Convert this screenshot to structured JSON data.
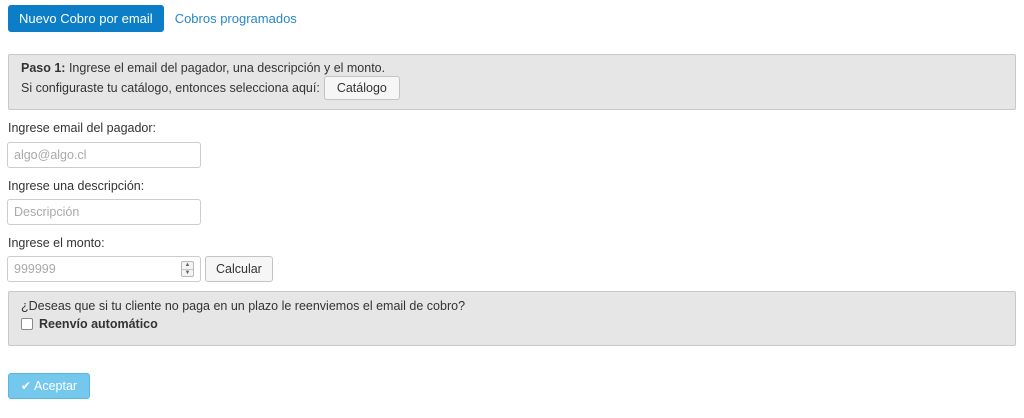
{
  "tabs": {
    "active_label": "Nuevo Cobro por email",
    "secondary_label": "Cobros programados"
  },
  "step_panel": {
    "step_bold": "Paso 1:",
    "step_text": " Ingrese el email del pagador, una descripción y el monto.",
    "catalog_text": "Si configuraste tu catálogo, entonces selecciona aquí:",
    "catalog_button": "Catálogo"
  },
  "form": {
    "email_label": "Ingrese email del pagador:",
    "email_placeholder": "algo@algo.cl",
    "email_value": "",
    "description_label": "Ingrese una descripción:",
    "description_placeholder": "Descripción",
    "description_value": "",
    "amount_label": "Ingrese el monto:",
    "amount_placeholder": "999999",
    "amount_value": "",
    "calculate_button": "Calcular"
  },
  "resend_panel": {
    "question": "¿Deseas que si tu cliente no paga en un plazo le reenviemos el email de cobro?",
    "checkbox_label": "Reenvío automático",
    "checked": false
  },
  "actions": {
    "accept_label": "Aceptar",
    "accept_icon": "check-icon"
  },
  "colors": {
    "tab_active": "#0b7ec7",
    "link": "#2a87c7",
    "panel_bg": "#e6e6e6",
    "accept_bg": "#74c8ee"
  }
}
